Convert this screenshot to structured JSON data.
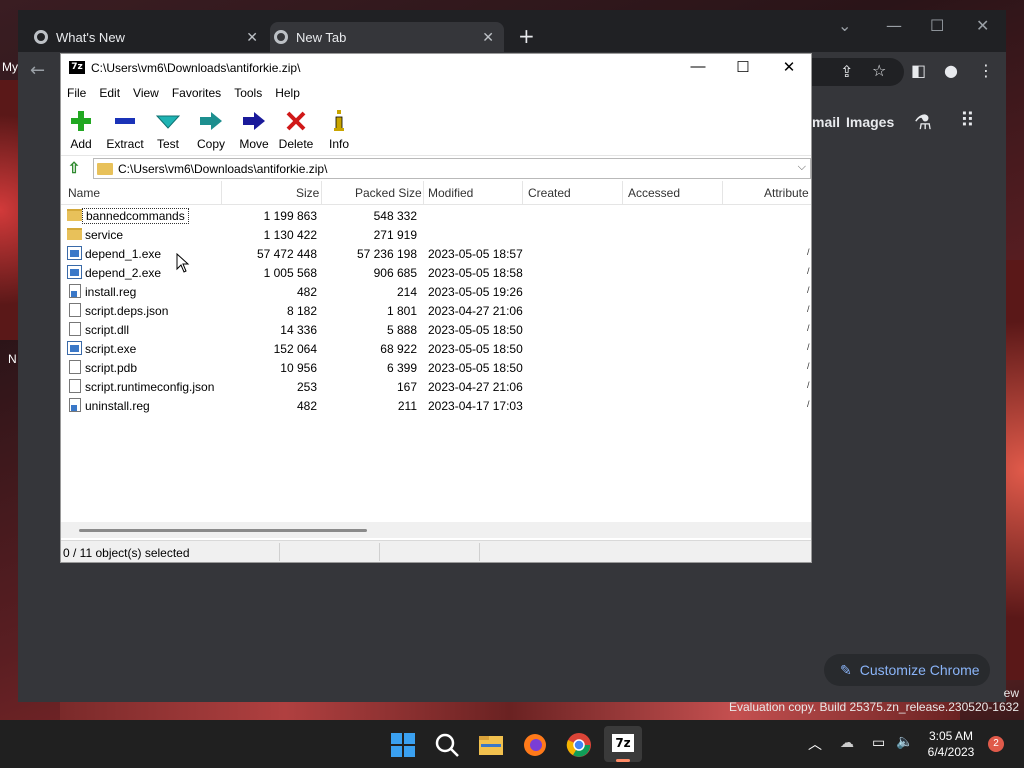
{
  "desktop": {
    "label_left": "My",
    "label_left2": "N"
  },
  "browser": {
    "tabs": [
      {
        "label": "What's New",
        "close": "✕"
      },
      {
        "label": "New Tab",
        "close": "✕"
      }
    ],
    "new_tab": "+",
    "ntp_links": {
      "gmail": "mail",
      "images": "Images"
    },
    "customize_label": "Customize Chrome"
  },
  "sevenzip": {
    "title": "C:\\Users\\vm6\\Downloads\\antiforkie.zip\\",
    "app_icon_text": "7z",
    "menu": [
      "File",
      "Edit",
      "View",
      "Favorites",
      "Tools",
      "Help"
    ],
    "toolbar": [
      {
        "label": "Add",
        "icon": "add-icon",
        "color": "#22a822"
      },
      {
        "label": "Extract",
        "icon": "extract-icon",
        "color": "#1a33b8"
      },
      {
        "label": "Test",
        "icon": "test-icon",
        "color": "#1fb3b3"
      },
      {
        "label": "Copy",
        "icon": "copy-icon",
        "color": "#1d8f8f"
      },
      {
        "label": "Move",
        "icon": "move-icon",
        "color": "#1a1a9a"
      },
      {
        "label": "Delete",
        "icon": "delete-icon",
        "color": "#d01818"
      },
      {
        "label": "Info",
        "icon": "info-icon",
        "color": "#c9a500"
      }
    ],
    "address": "C:\\Users\\vm6\\Downloads\\antiforkie.zip\\",
    "columns": [
      "Name",
      "Size",
      "Packed Size",
      "Modified",
      "Created",
      "Accessed",
      "Attribute"
    ],
    "files": [
      {
        "name": "bannedcommands",
        "size": "1 199 863",
        "packed": "548 332",
        "modified": "",
        "type": "folder"
      },
      {
        "name": "service",
        "size": "1 130 422",
        "packed": "271 919",
        "modified": "",
        "type": "folder"
      },
      {
        "name": "depend_1.exe",
        "size": "57 472 448",
        "packed": "57 236 198",
        "modified": "2023-05-05 18:57",
        "type": "exe"
      },
      {
        "name": "depend_2.exe",
        "size": "1 005 568",
        "packed": "906 685",
        "modified": "2023-05-05 18:58",
        "type": "exe"
      },
      {
        "name": "install.reg",
        "size": "482",
        "packed": "214",
        "modified": "2023-05-05 19:26",
        "type": "reg"
      },
      {
        "name": "script.deps.json",
        "size": "8 182",
        "packed": "1 801",
        "modified": "2023-04-27 21:06",
        "type": "doc"
      },
      {
        "name": "script.dll",
        "size": "14 336",
        "packed": "5 888",
        "modified": "2023-05-05 18:50",
        "type": "doc"
      },
      {
        "name": "script.exe",
        "size": "152 064",
        "packed": "68 922",
        "modified": "2023-05-05 18:50",
        "type": "exe"
      },
      {
        "name": "script.pdb",
        "size": "10 956",
        "packed": "6 399",
        "modified": "2023-05-05 18:50",
        "type": "doc"
      },
      {
        "name": "script.runtimeconfig.json",
        "size": "253",
        "packed": "167",
        "modified": "2023-04-27 21:06",
        "type": "doc"
      },
      {
        "name": "uninstall.reg",
        "size": "482",
        "packed": "211",
        "modified": "2023-04-17 17:03",
        "type": "reg"
      }
    ],
    "status": "0 / 11 object(s) selected"
  },
  "watermark": {
    "line1": "ew",
    "line2": "Evaluation copy. Build 25375.zn_release.230520-1632"
  },
  "taskbar": {
    "time": "3:05 AM",
    "date": "6/4/2023",
    "notifications": "2",
    "sevenzip_label": "7z"
  }
}
